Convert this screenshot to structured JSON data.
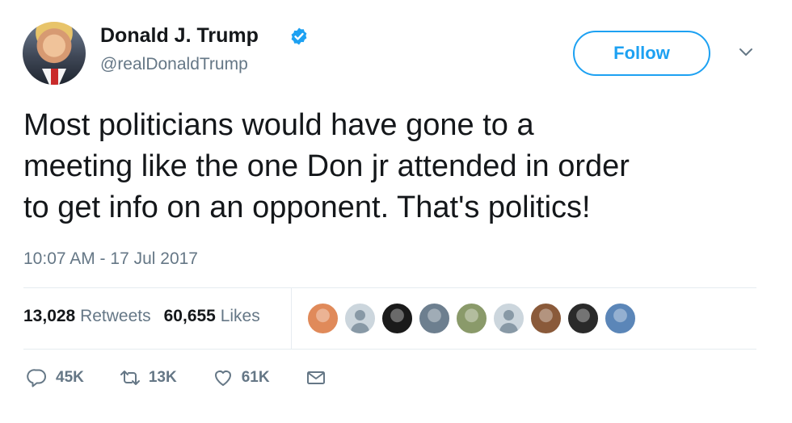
{
  "author": {
    "name": "Donald J. Trump",
    "handle": "@realDonaldTrump",
    "verified": true
  },
  "header": {
    "follow_label": "Follow"
  },
  "tweet": {
    "text_lines": [
      "Most politicians would have gone to a",
      "meeting like the one Don jr attended in order",
      "to get info on an opponent. That's politics!"
    ],
    "timestamp": "10:07 AM - 17 Jul 2017"
  },
  "stats": {
    "retweets_count": "13,028",
    "retweets_label": "Retweets",
    "likes_count": "60,655",
    "likes_label": "Likes"
  },
  "likers": [
    {
      "type": "photo",
      "color": "#e08a5a"
    },
    {
      "type": "default",
      "color": "#ccd6dd"
    },
    {
      "type": "photo",
      "color": "#1a1a1a"
    },
    {
      "type": "photo",
      "color": "#6d7f8f"
    },
    {
      "type": "photo",
      "color": "#8a9a6a"
    },
    {
      "type": "default",
      "color": "#ccd6dd"
    },
    {
      "type": "photo",
      "color": "#8a5a3a"
    },
    {
      "type": "photo",
      "color": "#2a2a2a"
    },
    {
      "type": "photo",
      "color": "#5b86b8"
    }
  ],
  "actions": {
    "reply_count": "45K",
    "retweet_count": "13K",
    "like_count": "61K"
  },
  "colors": {
    "accent": "#1da1f2",
    "text": "#14171a",
    "muted": "#657786"
  }
}
